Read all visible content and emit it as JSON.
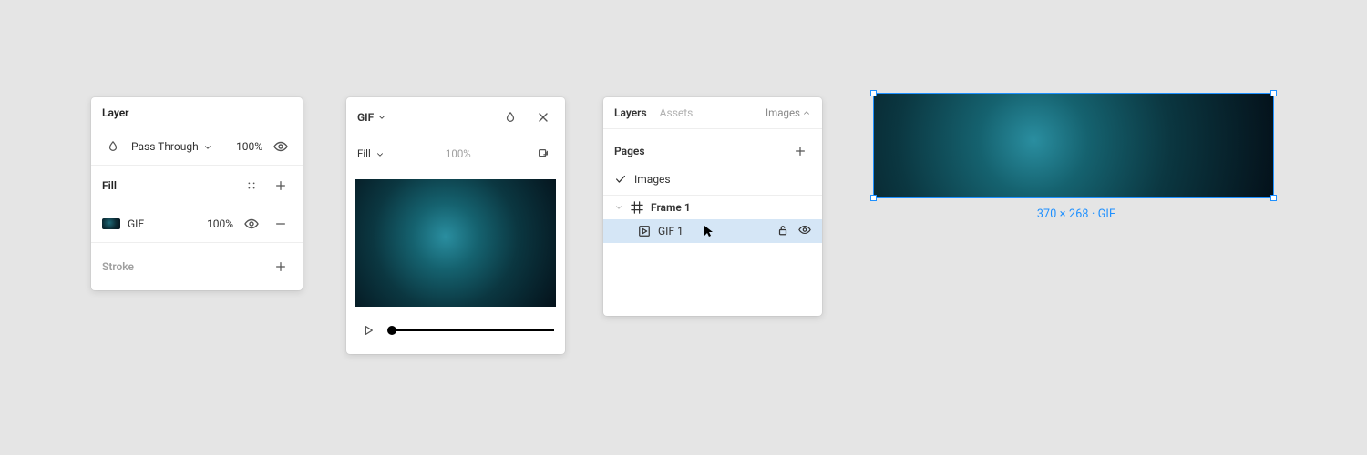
{
  "layer_panel": {
    "title": "Layer",
    "blend_mode": "Pass Through",
    "opacity": "100%",
    "fill_title": "Fill",
    "fill_label": "GIF",
    "fill_opacity": "100%",
    "stroke_title": "Stroke"
  },
  "gif_popover": {
    "title": "GIF",
    "fill_label": "Fill",
    "fill_opacity": "100%"
  },
  "layers_panel": {
    "tab_layers": "Layers",
    "tab_assets": "Assets",
    "right_label": "Images",
    "pages_title": "Pages",
    "page_active": "Images",
    "frame_name": "Frame 1",
    "layer_name": "GIF 1"
  },
  "canvas": {
    "label": "370 × 268 · GIF"
  }
}
